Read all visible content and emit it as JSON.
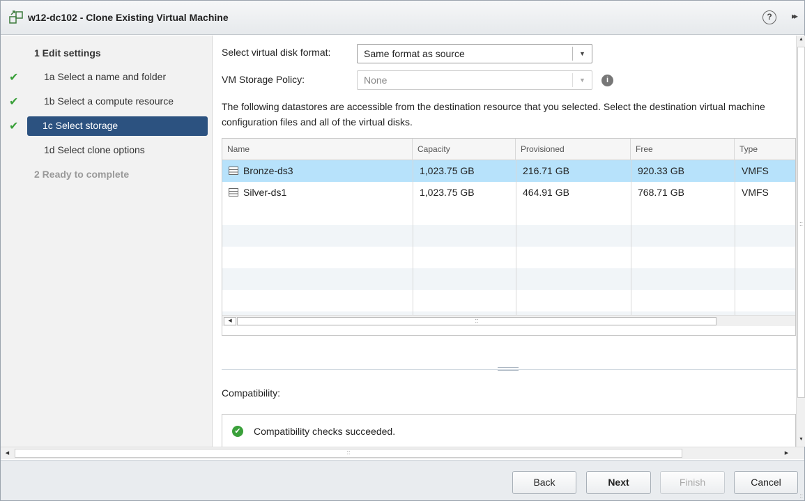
{
  "window": {
    "title": "w12-dc102 - Clone Existing Virtual Machine",
    "help_label": "?",
    "expand_label": "▸▸"
  },
  "nav": {
    "step1": "1 Edit settings",
    "step1a": "1a Select a name and folder",
    "step1b": "1b Select a compute resource",
    "step1c": "1c Select storage",
    "step1d": "1d Select clone options",
    "step2": "2 Ready to complete",
    "check": "✔"
  },
  "form": {
    "disk_format_label": "Select virtual disk format:",
    "disk_format_value": "Same format as source",
    "policy_label": "VM Storage Policy:",
    "policy_value": "None",
    "info_glyph": "i",
    "dropdown_glyph": "▼",
    "description": "The following datastores are accessible from the destination resource that you selected. Select the destination virtual machine configuration files and all of the virtual disks."
  },
  "table": {
    "columns": [
      "Name",
      "Capacity",
      "Provisioned",
      "Free",
      "Type"
    ],
    "rows": [
      {
        "name": "Bronze-ds3",
        "capacity": "1,023.75 GB",
        "provisioned": "216.71 GB",
        "free": "920.33 GB",
        "type": "VMFS",
        "selected": true
      },
      {
        "name": "Silver-ds1",
        "capacity": "1,023.75 GB",
        "provisioned": "464.91 GB",
        "free": "768.71 GB",
        "type": "VMFS",
        "selected": false
      }
    ],
    "scroll_left_glyph": "◀",
    "grip_glyph": "::"
  },
  "compatibility": {
    "label": "Compatibility:",
    "message": "Compatibility checks succeeded.",
    "ok_glyph": "✔"
  },
  "scroll": {
    "up_glyph": "▲",
    "down_glyph": "▼",
    "left_glyph": "◀",
    "right_glyph": "▶",
    "grip_glyph": "::"
  },
  "footer": {
    "back": "Back",
    "next": "Next",
    "finish": "Finish",
    "cancel": "Cancel"
  },
  "colors": {
    "selected_step": "#2c5280",
    "selected_row": "#b7e2fb",
    "check_green": "#3aa03a"
  }
}
